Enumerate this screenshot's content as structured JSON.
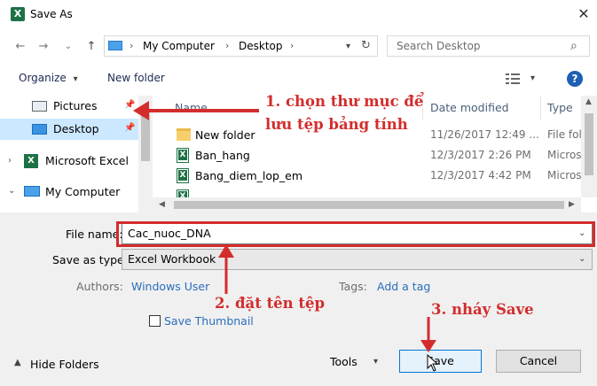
{
  "window": {
    "title": "Save As",
    "app_icon_letter": "X"
  },
  "nav": {
    "address": [
      "My Computer",
      "Desktop"
    ],
    "search_placeholder": "Search Desktop"
  },
  "toolbar": {
    "organize": "Organize",
    "new_folder": "New folder"
  },
  "sidebar": {
    "items": [
      {
        "label": "Pictures"
      },
      {
        "label": "Desktop"
      },
      {
        "label": "Microsoft Excel"
      },
      {
        "label": "My Computer"
      }
    ]
  },
  "file_list": {
    "columns": {
      "name": "Name",
      "date": "Date modified",
      "type": "Type"
    },
    "rows": [
      {
        "name": "New folder",
        "date": "11/26/2017 12:49 ...",
        "type": "File fol",
        "icon": "folder"
      },
      {
        "name": "Ban_hang",
        "date": "12/3/2017 2:26 PM",
        "type": "Micros",
        "icon": "excel"
      },
      {
        "name": "Bang_diem_lop_em",
        "date": "12/3/2017 4:42 PM",
        "type": "Micros",
        "icon": "excel"
      }
    ]
  },
  "form": {
    "file_name_label": "File name:",
    "file_name_value": "Cac_nuoc_DNA",
    "save_type_label": "Save as type:",
    "save_type_value": "Excel Workbook",
    "authors_label": "Authors:",
    "authors_value": "Windows User",
    "tags_label": "Tags:",
    "tags_value": "Add a tag",
    "thumbnail_label": "Save Thumbnail"
  },
  "footer": {
    "hide_folders": "Hide Folders",
    "tools": "Tools",
    "save": "Save",
    "cancel": "Cancel"
  },
  "annotations": {
    "step1_line1": "1. chọn thư mục để",
    "step1_line2": "lưu tệp bảng tính",
    "step2": "2. đặt tên tệp",
    "step3": "3. nháy Save",
    "color": "#d42c2c"
  }
}
